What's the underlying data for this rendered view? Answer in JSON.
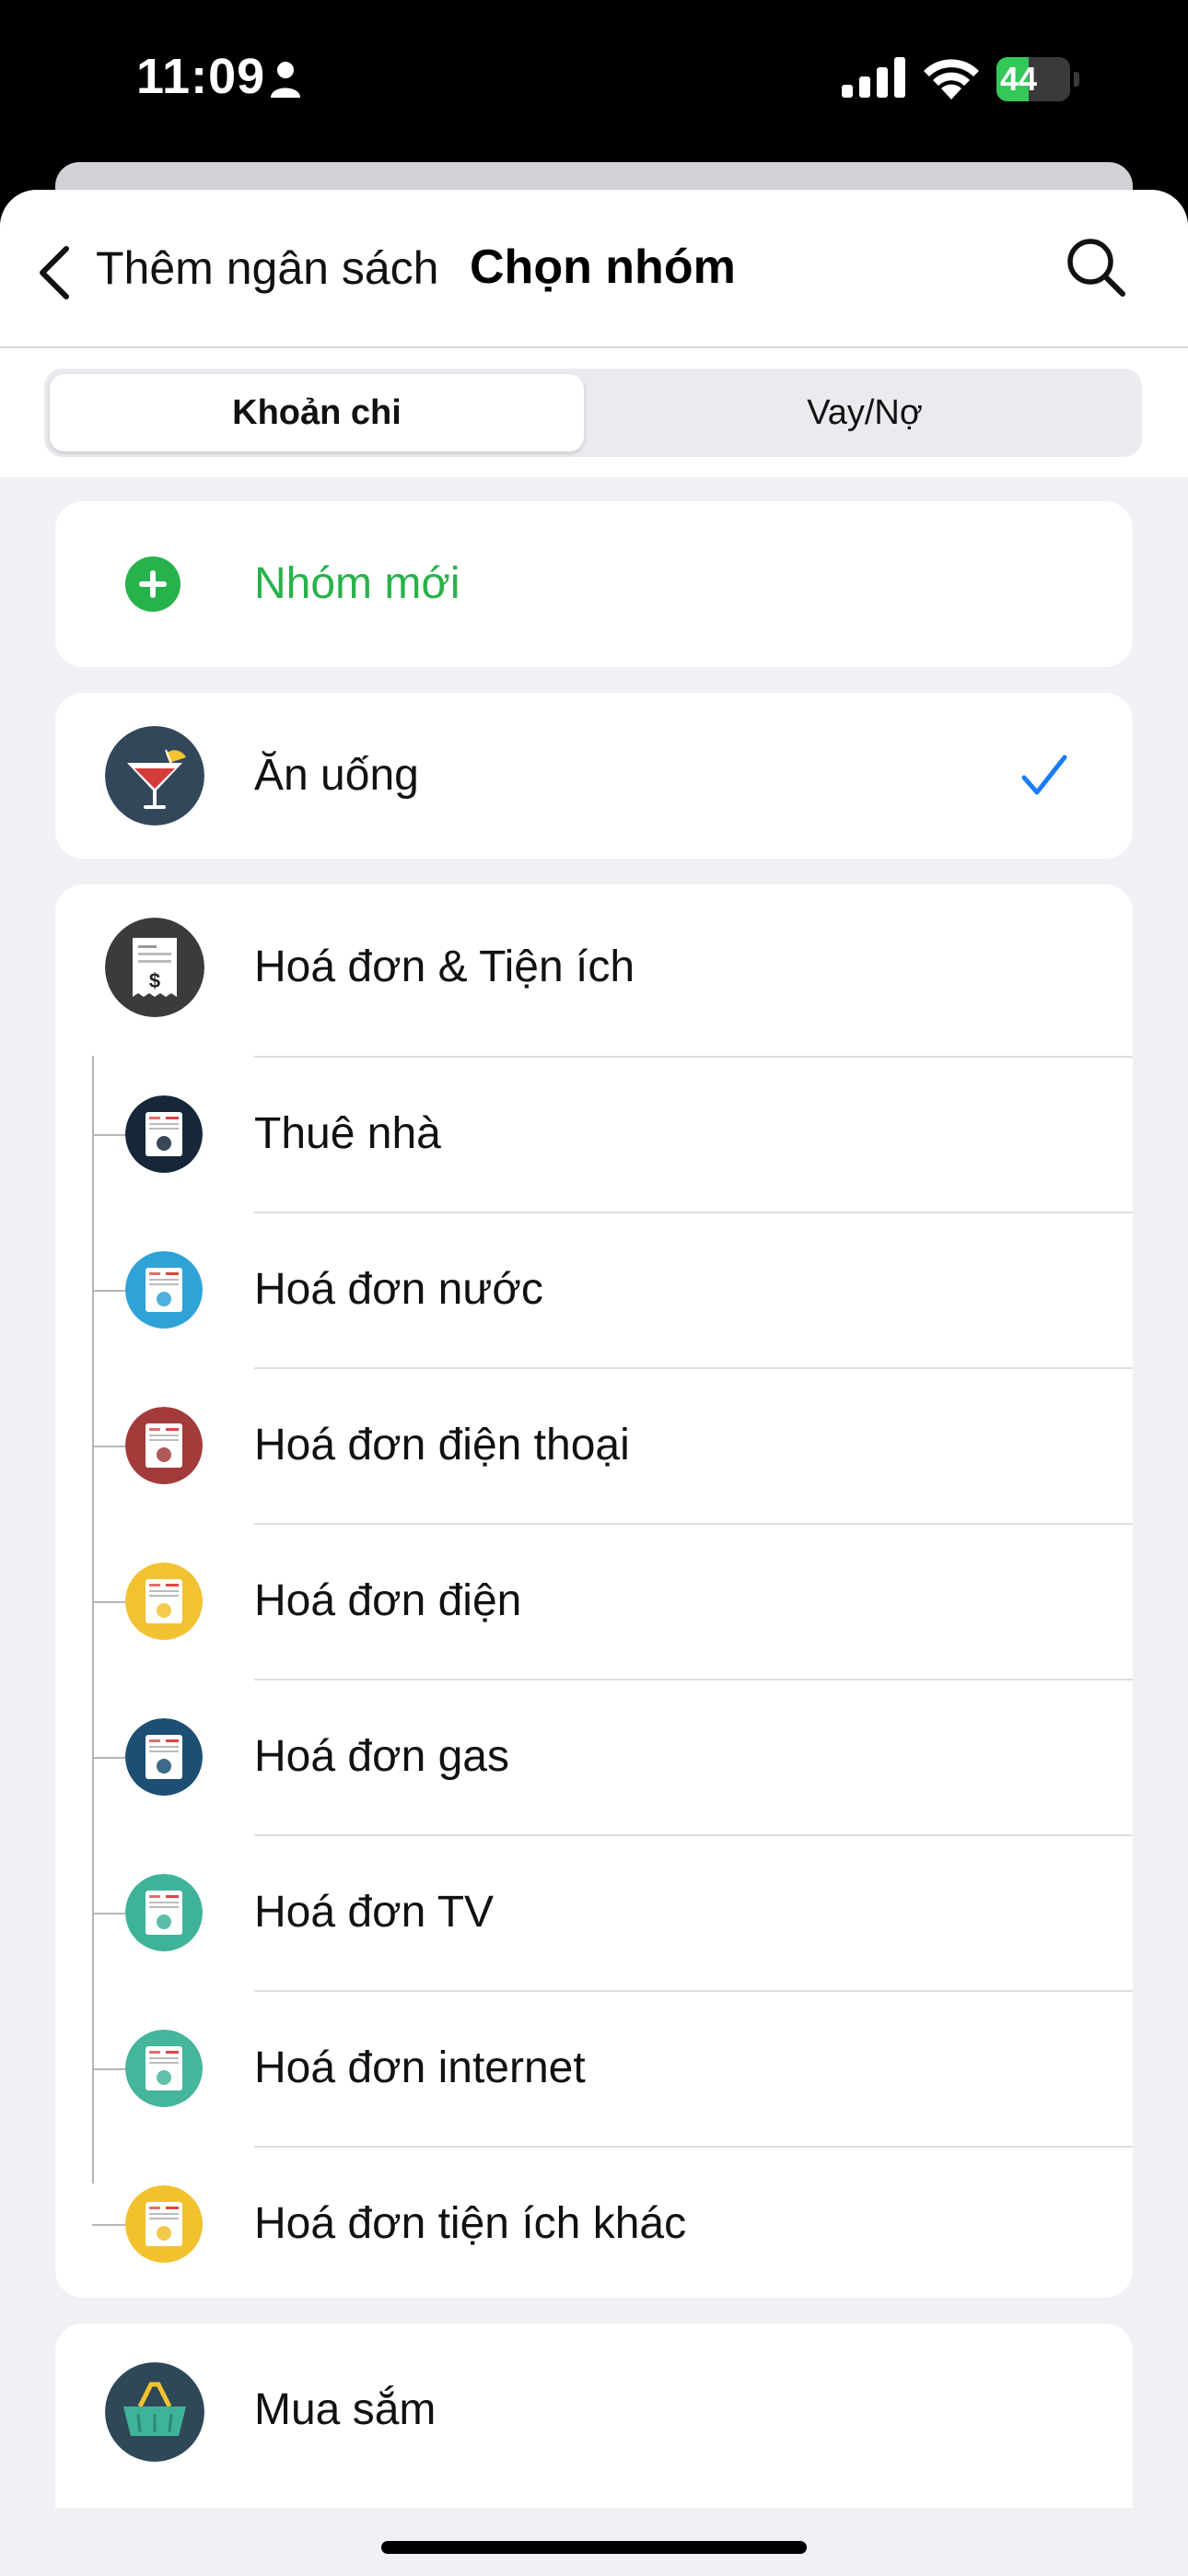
{
  "status_bar": {
    "time": "11:09",
    "battery": "44",
    "battery_level": 0.44
  },
  "header": {
    "back_label": "Thêm ngân sách",
    "title": "Chọn nhóm"
  },
  "tabs": [
    {
      "label": "Khoản chi",
      "active": true
    },
    {
      "label": "Vay/Nợ",
      "active": false
    }
  ],
  "new_group": {
    "label": "Nhóm mới"
  },
  "selected_group": {
    "label": "Ăn uống",
    "checked": true,
    "icon": "cocktail-icon"
  },
  "bills_group": {
    "label": "Hoá đơn & Tiện ích",
    "icon": "bill-icon",
    "children": [
      {
        "label": "Thuê nhà",
        "icon": "house-bill-icon",
        "color": "#16273a"
      },
      {
        "label": "Hoá đơn nước",
        "icon": "water-bill-icon",
        "color": "#2fa2d8"
      },
      {
        "label": "Hoá đơn điện thoại",
        "icon": "phone-bill-icon",
        "color": "#a33b3b"
      },
      {
        "label": "Hoá đơn điện",
        "icon": "electric-bill-icon",
        "color": "#f1c232"
      },
      {
        "label": "Hoá đơn gas",
        "icon": "gas-bill-icon",
        "color": "#1c4f73"
      },
      {
        "label": "Hoá đơn TV",
        "icon": "tv-bill-icon",
        "color": "#3fb39a"
      },
      {
        "label": "Hoá đơn internet",
        "icon": "internet-bill-icon",
        "color": "#45b59c"
      },
      {
        "label": "Hoá đơn tiện ích khác",
        "icon": "other-bill-icon",
        "color": "#f2c12e"
      }
    ]
  },
  "shopping_group": {
    "label": "Mua sắm",
    "icon": "basket-icon"
  },
  "colors": {
    "accent_green": "#27b24a",
    "check_blue": "#1a7cf5"
  }
}
